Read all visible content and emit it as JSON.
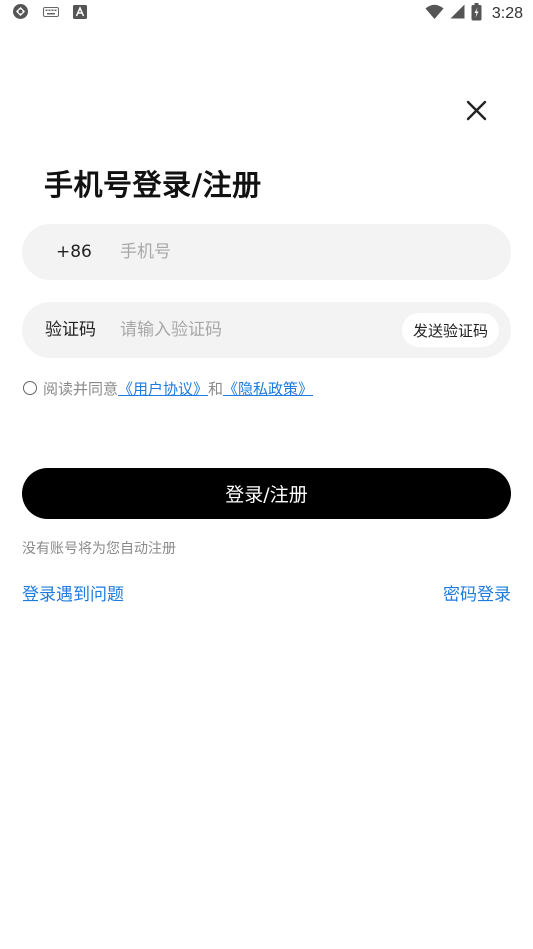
{
  "status_bar": {
    "time": "3:28",
    "left_icons": [
      "app-icon",
      "keyboard-icon",
      "font-icon"
    ],
    "right_icons": [
      "wifi-icon",
      "signal-icon",
      "battery-icon"
    ]
  },
  "header": {
    "close_icon": "close-icon",
    "title": "手机号登录/注册"
  },
  "phone_field": {
    "prefix": "+86",
    "placeholder": "手机号",
    "value": ""
  },
  "code_field": {
    "label": "验证码",
    "placeholder": "请输入验证码",
    "value": "",
    "send_button": "发送验证码"
  },
  "agreement": {
    "checked": false,
    "prefix": "阅读并同意",
    "user_agreement": "《用户协议》",
    "conjunction": "和",
    "privacy_policy": "《隐私政策》"
  },
  "login_button": "登录/注册",
  "auto_register_note": "没有账号将为您自动注册",
  "links": {
    "trouble": "登录遇到问题",
    "password_login": "密码登录"
  },
  "colors": {
    "accent_link": "#1e7be0",
    "primary_button": "#000000",
    "field_background": "#f3f3f3",
    "muted_text": "#8a8a8a"
  }
}
